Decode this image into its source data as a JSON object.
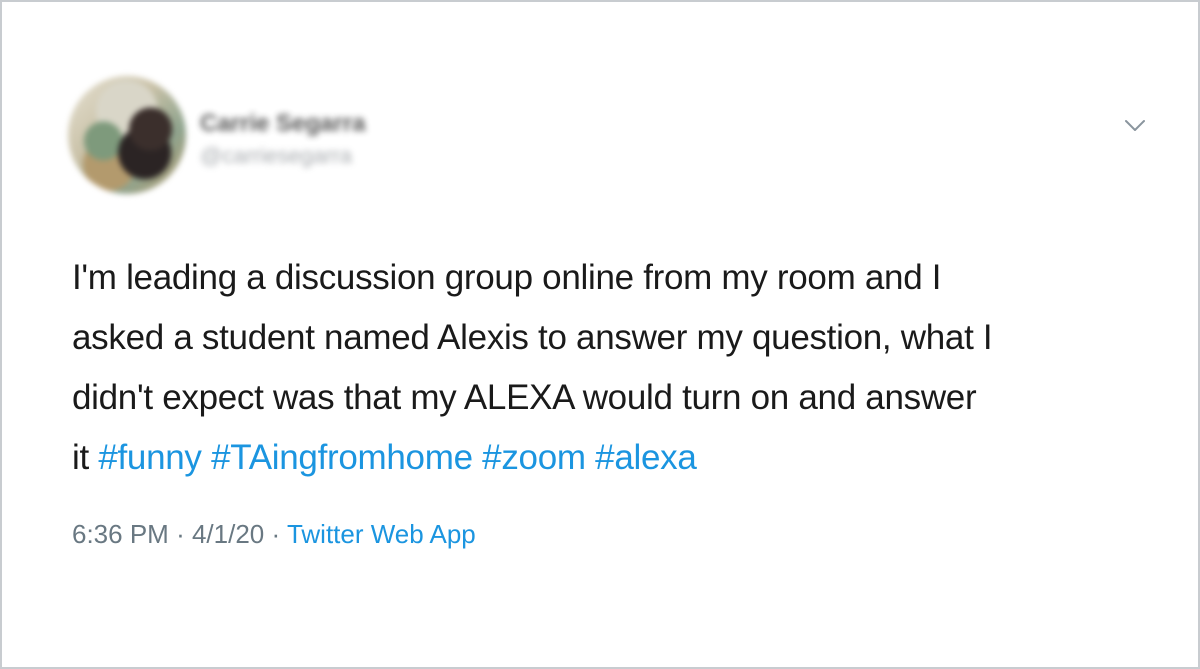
{
  "author": {
    "display_name": "Carrie Segarra",
    "handle": "@carriesegarra"
  },
  "tweet": {
    "lines": [
      "I'm leading a discussion group online from my room and I",
      "asked a student named Alexis to answer my question, what I",
      "didn't expect was that my ALEXA would turn on and answer"
    ],
    "last_line_prefix": "it",
    "hashtags": [
      "#funny",
      "#TAingfromhome",
      "#zoom",
      "#alexa"
    ]
  },
  "meta": {
    "time": "6:36 PM",
    "separator": "·",
    "date": "4/1/20",
    "source": "Twitter Web App"
  },
  "colors": {
    "link": "#1b95e0",
    "text": "#1a1a1a",
    "muted": "#697882",
    "border": "#c8ccd0"
  },
  "icons": {
    "menu": "chevron-down-icon"
  }
}
